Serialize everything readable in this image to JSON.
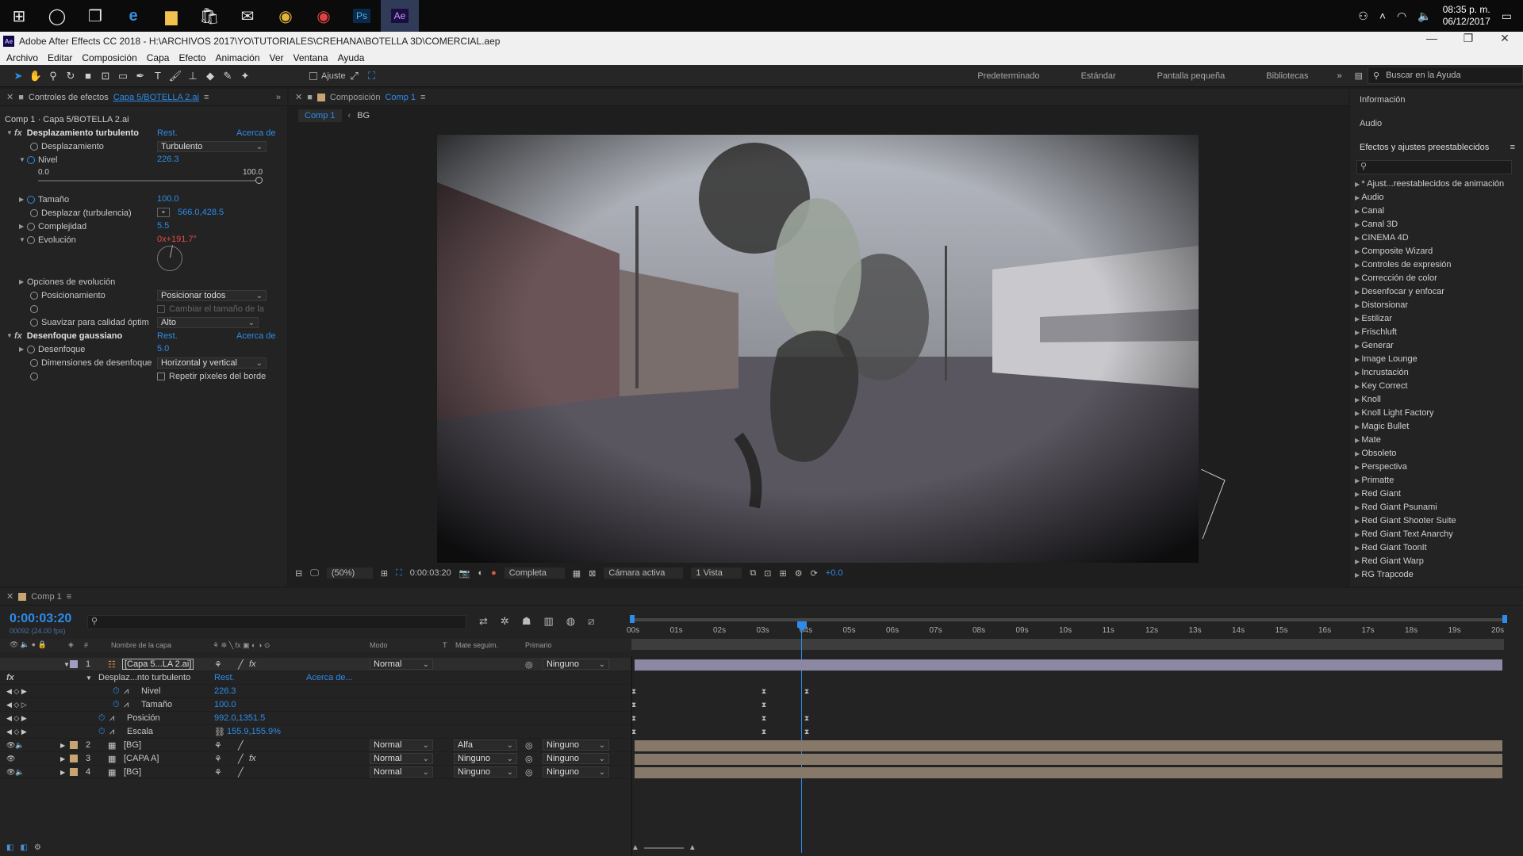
{
  "taskbar": {
    "time": "08:35 p. m.",
    "date": "06/12/2017"
  },
  "window": {
    "title": "Adobe After Effects CC 2018 - H:\\ARCHIVOS 2017\\YO\\TUTORIALES\\CREHANA\\BOTELLA 3D\\COMERCIAL.aep",
    "logo": "Ae"
  },
  "menu": [
    "Archivo",
    "Editar",
    "Composición",
    "Capa",
    "Efecto",
    "Animación",
    "Ver",
    "Ventana",
    "Ayuda"
  ],
  "toolbar": {
    "snap_label": "Ajuste",
    "workspaces": [
      "Predeterminado",
      "Estándar",
      "Pantalla pequeña",
      "Bibliotecas"
    ],
    "help_search": "Buscar en la Ayuda"
  },
  "effects": {
    "tab_prefix": "Controles de efectos",
    "tab_layer": "Capa 5/BOTELLA 2.ai",
    "context": "Comp 1 · Capa 5/BOTELLA 2.ai",
    "rest": "Rest.",
    "about": "Acerca de",
    "e1_name": "Desplazamiento turbulento",
    "displacement_label": "Desplazamiento",
    "displacement_value": "Turbulento",
    "amount_label": "Nivel",
    "amount_value": "226.3",
    "slider_min": "0.0",
    "slider_max": "100.0",
    "size_label": "Tamaño",
    "size_value": "100.0",
    "offset_label": "Desplazar (turbulencia)",
    "offset_value": "566.0,428.5",
    "complexity_label": "Complejidad",
    "complexity_value": "5.5",
    "evolution_label": "Evolución",
    "evolution_value": "0x+191.7°",
    "evolution_options": "Opciones de evolución",
    "pinning_label": "Posicionamiento",
    "pinning_value": "Posicionar todos",
    "resize_label": "Cambiar el tamaño de la",
    "antialias_label": "Suavizar para calidad óptim",
    "antialias_value": "Alto",
    "e2_name": "Desenfoque gaussiano",
    "blur_label": "Desenfoque",
    "blur_value": "5.0",
    "blurdim_label": "Dimensiones de desenfoque",
    "blurdim_value": "Horizontal y vertical",
    "repeat_label": "Repetir píxeles del borde"
  },
  "comp": {
    "tab_prefix": "Composición",
    "tab_name": "Comp 1",
    "crumbs": [
      "Comp 1",
      "BG"
    ],
    "zoom": "(50%)",
    "timecode": "0:00:03:20",
    "quality": "Completa",
    "camera": "Cámara activa",
    "views": "1 Vista",
    "exposure": "+0.0"
  },
  "right": {
    "info": "Información",
    "audio": "Audio",
    "presets": "Efectos y ajustes preestablecidos",
    "items": [
      "* Ajust...reestablecidos de animación",
      "Audio",
      "Canal",
      "Canal 3D",
      "CINEMA 4D",
      "Composite Wizard",
      "Controles de expresión",
      "Corrección de color",
      "Desenfocar y enfocar",
      "Distorsionar",
      "Estilizar",
      "Frischluft",
      "Generar",
      "Image Lounge",
      "Incrustación",
      "Key Correct",
      "Knoll",
      "Knoll Light Factory",
      "Magic Bullet",
      "Mate",
      "Obsoleto",
      "Perspectiva",
      "Primatte",
      "Red Giant",
      "Red Giant Psunami",
      "Red Giant Shooter Suite",
      "Red Giant Text Anarchy",
      "Red Giant ToonIt",
      "Red Giant Warp",
      "RG Trapcode"
    ]
  },
  "timeline": {
    "tab": "Comp 1",
    "timecode": "0:00:03:20",
    "fps": "00092 (24.00 fps)",
    "cols": {
      "num": "#",
      "name": "Nombre de la capa",
      "mode": "Modo",
      "t": "T",
      "matte": "Mate seguim.",
      "parent": "Primario"
    },
    "ruler": [
      "00s",
      "01s",
      "02s",
      "03s",
      "04s",
      "05s",
      "06s",
      "07s",
      "08s",
      "09s",
      "10s",
      "11s",
      "12s",
      "13s",
      "14s",
      "15s",
      "16s",
      "17s",
      "18s",
      "19s",
      "20s"
    ],
    "layer1": {
      "num": "1",
      "name": "[Capa 5...LA 2.ai]",
      "mode": "Normal",
      "parent": "Ninguno"
    },
    "effect_row": {
      "name": "Desplaz...nto turbulento",
      "rest": "Rest.",
      "about": "Acerca de..."
    },
    "sub": [
      {
        "label": "Nivel",
        "value": "226.3"
      },
      {
        "label": "Tamaño",
        "value": "100.0"
      },
      {
        "label": "Posición",
        "value": "992.0,1351.5"
      },
      {
        "label": "Escala",
        "value": "155.9,155.9%"
      }
    ],
    "layers": [
      {
        "num": "2",
        "name": "[BG]",
        "mode": "Normal",
        "matte": "Alfa",
        "parent": "Ninguno"
      },
      {
        "num": "3",
        "name": "[CAPA A]",
        "mode": "Normal",
        "matte": "Ninguno",
        "parent": "Ninguno"
      },
      {
        "num": "4",
        "name": "[BG]",
        "mode": "Normal",
        "matte": "Ninguno",
        "parent": "Ninguno"
      }
    ]
  }
}
